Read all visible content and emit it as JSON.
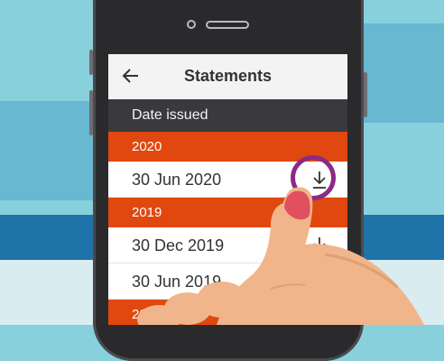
{
  "header": {
    "title": "Statements",
    "back_icon": "back-arrow-icon"
  },
  "list_header": {
    "label": "Date issued"
  },
  "statements": [
    {
      "year": "2020",
      "items": [
        {
          "date": "30 Jun 2020",
          "icon": "download-icon"
        }
      ]
    },
    {
      "year": "2019",
      "items": [
        {
          "date": "30 Dec 2019",
          "icon": "download-icon"
        },
        {
          "date": "30 Jun 2019",
          "icon": "download-icon"
        }
      ]
    },
    {
      "year": "2018",
      "items": []
    }
  ],
  "colors": {
    "accent": "#e0480f",
    "header_bg": "#f3f3f3",
    "subheader_bg": "#3a3a3e",
    "highlight_ring": "#8b2a86",
    "fingernail": "#e0505e",
    "skin": "#f0b58a"
  }
}
